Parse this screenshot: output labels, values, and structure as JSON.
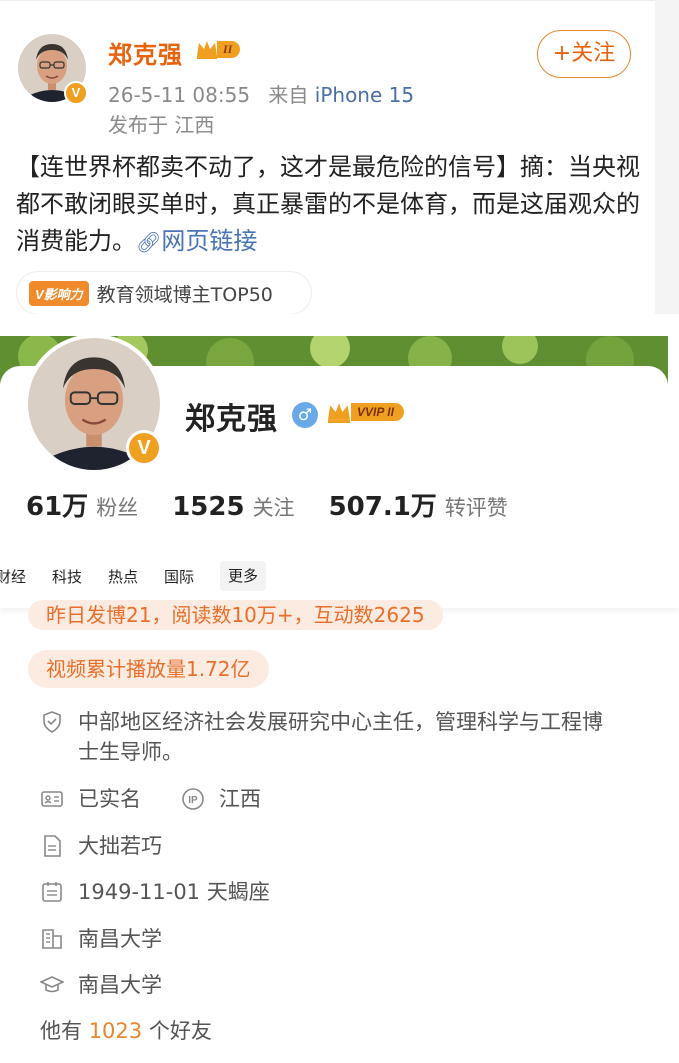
{
  "post": {
    "author": "郑克强",
    "vip_badge": "II",
    "verified": "V",
    "date": "26-5-11 08:55",
    "source_prefix": "来自",
    "source_device": "iPhone 15",
    "location": "发布于 江西",
    "follow_label": "+关注",
    "text": "【连世界杯都卖不动了，这才是最危险的信号】摘：当央视都不敢闭眼买单时，真正暴雷的不是体育，而是这届观众的消费能力。",
    "link_label": "网页链接",
    "influence_badge": "V影响力",
    "influence_text": "教育领域博主TOP50"
  },
  "profile": {
    "name": "郑克强",
    "gender_icon": "male-icon",
    "vip_badge": "VVIP II",
    "verified": "V",
    "stats": [
      {
        "num": "61万",
        "label": "粉丝"
      },
      {
        "num": "1525",
        "label": "关注"
      },
      {
        "num": "507.1万",
        "label": "转评赞"
      }
    ]
  },
  "nav": {
    "items": [
      "财经",
      "科技",
      "热点",
      "国际"
    ],
    "more": "更多"
  },
  "details": {
    "pill_yesterday": "昨日发博21，阅读数10万+，互动数2625",
    "pill_video": "视频累计播放量1.72亿",
    "bio": "中部地区经济社会发展研究中心主任，管理科学与工程博士生导师。",
    "verified_label": "已实名",
    "ip_label": "江西",
    "motto": "大拙若巧",
    "birthday": "1949-11-01 天蝎座",
    "company": "南昌大学",
    "school": "南昌大学",
    "friends_prefix": "他有",
    "friends_count": "1023",
    "friends_suffix": "个好友"
  },
  "colors": {
    "brand_orange": "#e8620c",
    "link_blue": "#4a74b8",
    "pill_bg": "#fcebe0",
    "pill_text": "#e96e2a",
    "gold": "#f0a020"
  }
}
